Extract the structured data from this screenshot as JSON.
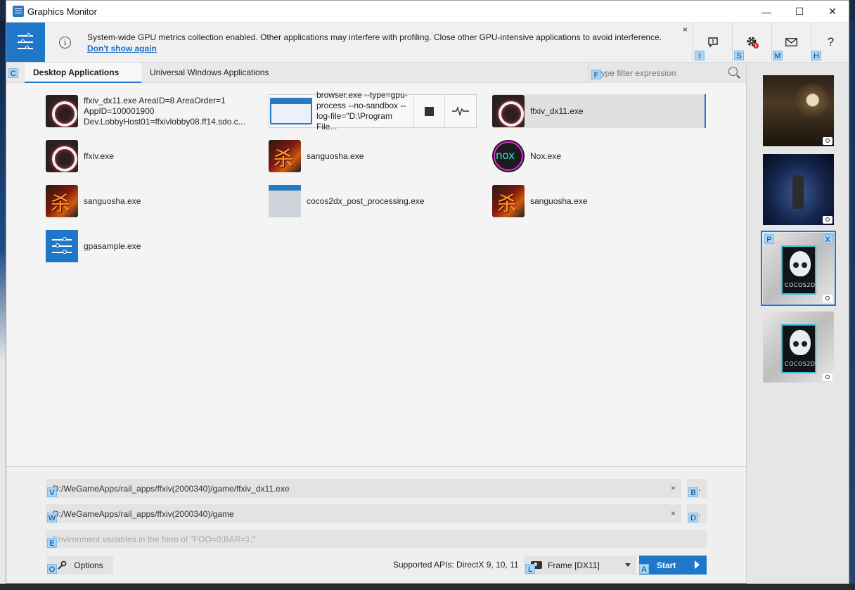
{
  "window": {
    "title": "Graphics Monitor",
    "controls": {
      "minimize": "—",
      "maximize": "☐",
      "close": "✕"
    }
  },
  "infobar": {
    "message": "System-wide GPU metrics collection enabled. Other applications may interfere with profiling. Close other GPU-intensive applications to avoid interference. ",
    "link": "Don't show again",
    "close": "×",
    "help": "?"
  },
  "hints": {
    "info": "I",
    "settings": "S",
    "mail": "M",
    "help": "H",
    "tab": "C",
    "filter": "F",
    "path": "V",
    "workdir": "W",
    "env": "E",
    "options": "O",
    "mode": "L",
    "start": "A",
    "browse_path": "B",
    "browse_dir": "D",
    "pin": "P",
    "remove": "X"
  },
  "tabs": [
    {
      "label": "Desktop Applications"
    },
    {
      "label": "Universal Windows Applications"
    }
  ],
  "filter": {
    "placeholder": "Type filter expression"
  },
  "apps": [
    {
      "name": "ffxiv_dx11.exe AreaID=8 AreaOrder=1 AppID=100001900 Dev.LobbyHost01=ffxivlobby08.ff14.sdo.c...",
      "icon": "ffxiv-icon"
    },
    {
      "name": "browser.exe --type=gpu-process --no-sandbox --log-file=\"D:\\Program File...",
      "icon": "browser-window-icon"
    },
    {
      "name": "ffxiv_dx11.exe",
      "icon": "ffxiv-icon"
    },
    {
      "name": "ffxiv.exe",
      "icon": "ffxiv-icon"
    },
    {
      "name": "sanguosha.exe",
      "icon": "sanguosha-icon"
    },
    {
      "name": "Nox.exe",
      "icon": "nox-icon"
    },
    {
      "name": "sanguosha.exe",
      "icon": "sanguosha-icon"
    },
    {
      "name": "cocos2dx_post_processing.exe",
      "icon": "window-icon"
    },
    {
      "name": "sanguosha.exe",
      "icon": "sanguosha-icon"
    },
    {
      "name": "gpasample.exe",
      "icon": "gpasample-icon"
    }
  ],
  "launch": {
    "path": "D:/WeGameApps/rail_apps/ffxiv(2000340)/game/ffxiv_dx11.exe",
    "workdir": "D:/WeGameApps/rail_apps/ffxiv(2000340)/game",
    "env_placeholder": "Environment variables in the form of \"FOO=0;BAR=1;\"",
    "clear": "×",
    "browse": "…",
    "options": "Options",
    "apis": "Supported APIs: DirectX 9, 10, 11",
    "mode": "Frame [DX11]",
    "start": "Start"
  },
  "colors": {
    "accent": "#1f77c9",
    "hint": "#a8d4f8",
    "badge": "#e0202c"
  }
}
